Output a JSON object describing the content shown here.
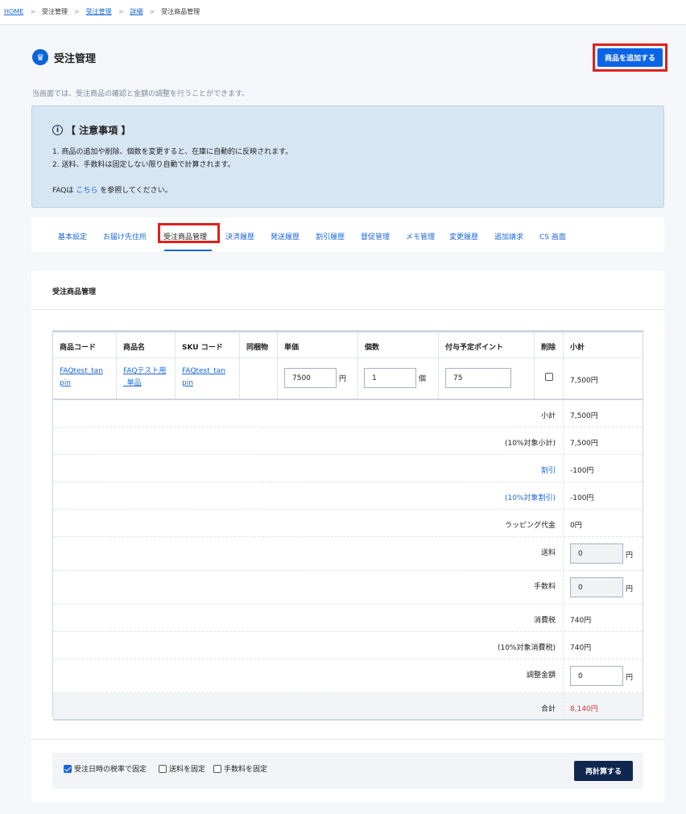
{
  "breadcrumb": {
    "items": [
      "HOME",
      "受注管理",
      "受注管理",
      "詳細",
      "受注商品管理"
    ],
    "sep": ">"
  },
  "page": {
    "title": "受注管理",
    "add_button": "商品を追加する",
    "description": "当画面では、受注商品の確認と金額の調整を行うことができます。"
  },
  "notice": {
    "title": "【 注意事項 】",
    "line1": "1. 商品の追加や削除、個数を変更すると、在庫に自動的に反映されます。",
    "line2": "2. 送料、手数料は固定しない限り自動で計算されます。",
    "faq_prefix": "FAQは",
    "faq_link": "こちら",
    "faq_suffix": "を参照してください。"
  },
  "tabs": [
    "基本設定",
    "お届け先住所",
    "受注商品管理",
    "決済履歴",
    "発送履歴",
    "割引履歴",
    "督促管理",
    "メモ管理",
    "変更履歴",
    "追加請求",
    "CS 画面"
  ],
  "panel": {
    "title": "受注商品管理"
  },
  "table": {
    "headers": [
      "商品コード",
      "商品名",
      "SKU コード",
      "同梱物",
      "単価",
      "個数",
      "付与予定ポイント",
      "削除",
      "小計"
    ],
    "row": {
      "code_line1": "FAQtest_tan",
      "code_line2": "pin",
      "name_line1": "FAQテスト用",
      "name_line2": "_単品",
      "sku_line1": "FAQtest_tan",
      "sku_line2": "pin",
      "price": "7500",
      "price_unit": "円",
      "qty": "1",
      "qty_unit": "個",
      "points": "75",
      "subtotal": "7,500円"
    }
  },
  "summary": {
    "subtotal_label": "小計",
    "subtotal_value": "7,500円",
    "tax10_subtotal_label": "(10%対象小計)",
    "tax10_subtotal_value": "7,500円",
    "discount_label": "割引",
    "discount_value": "-100円",
    "tax10_discount_label": "(10%対象割引)",
    "tax10_discount_value": "-100円",
    "wrapping_label": "ラッピング代金",
    "wrapping_value": "0円",
    "shipping_label": "送料",
    "shipping_value": "0",
    "shipping_unit": "円",
    "fee_label": "手数料",
    "fee_value": "0",
    "fee_unit": "円",
    "tax_label": "消費税",
    "tax_value": "740円",
    "tax10_label": "(10%対象消費税)",
    "tax10_value": "740円",
    "adjust_label": "調整金額",
    "adjust_value": "0",
    "adjust_unit": "円",
    "total_label": "合計",
    "total_value": "8,140円"
  },
  "options": {
    "fix_tax_rate": "受注日時の税率で固定",
    "fix_shipping": "送料を固定",
    "fix_fee": "手数料を固定",
    "recalc_button": "再計算する"
  }
}
